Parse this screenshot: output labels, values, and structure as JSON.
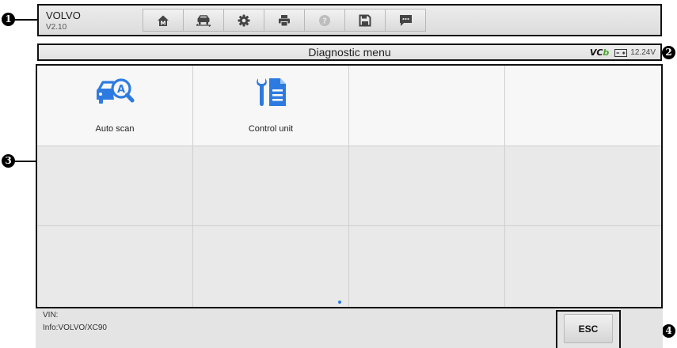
{
  "header": {
    "app_name": "VOLVO",
    "version": "V2.10",
    "tools": [
      {
        "name": "home-icon"
      },
      {
        "name": "vehicle-swap-icon"
      },
      {
        "name": "settings-icon"
      },
      {
        "name": "print-icon"
      },
      {
        "name": "help-icon",
        "disabled": true
      },
      {
        "name": "save-icon"
      },
      {
        "name": "message-icon"
      }
    ]
  },
  "status": {
    "title": "Diagnostic menu",
    "vci_prefix": "VC",
    "vci_suffix": "b",
    "battery_icon": "battery-icon",
    "voltage": "12.24V"
  },
  "menu": {
    "items": [
      {
        "label": "Auto scan",
        "icon": "auto-scan-icon"
      },
      {
        "label": "Control unit",
        "icon": "control-unit-icon"
      }
    ]
  },
  "footer": {
    "vin": "VIN:",
    "info": "Info:VOLVO/XC90",
    "esc_label": "ESC"
  },
  "callouts": [
    "1",
    "2",
    "3",
    "4"
  ],
  "colors": {
    "accent_blue": "#2d7be0",
    "vci_green": "#4aa52e"
  }
}
